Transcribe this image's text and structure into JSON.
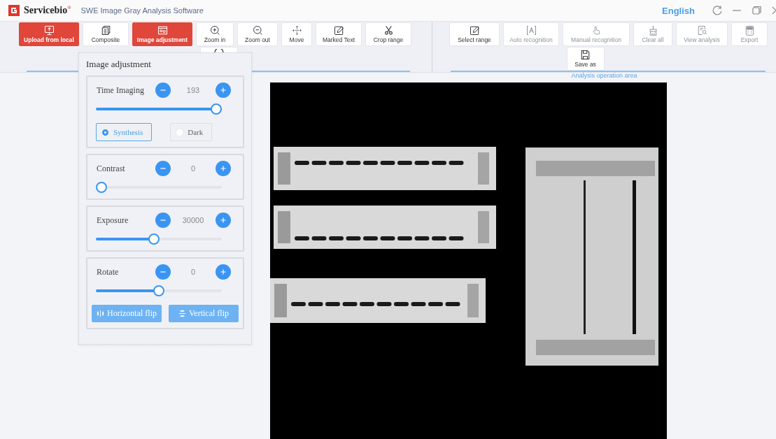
{
  "title_bar": {
    "logo": "Servicebio",
    "logo_mark": "®",
    "app_title": "SWE Image Gray Analysis Software",
    "language": "English"
  },
  "toolbar_left": [
    {
      "label": "Upload from local",
      "selected": true
    },
    {
      "label": "Composite",
      "selected": false
    },
    {
      "label": "Image adjustment",
      "selected": true
    },
    {
      "label": "Zoom in",
      "selected": false
    },
    {
      "label": "Zoom out",
      "selected": false
    },
    {
      "label": "Move",
      "selected": false
    },
    {
      "label": "Marked Text",
      "selected": false
    },
    {
      "label": "Crop range",
      "selected": false
    }
  ],
  "toolbar_right": [
    {
      "label": "Select range",
      "disabled": false
    },
    {
      "label": "Auto recognition",
      "disabled": true
    },
    {
      "label": "Manual recognition",
      "disabled": true
    },
    {
      "label": "Clear all",
      "disabled": true
    },
    {
      "label": "View analysis",
      "disabled": true
    },
    {
      "label": "Export",
      "disabled": true
    },
    {
      "label": "Save as",
      "disabled": false
    }
  ],
  "right_area_caption": "Analysis operation area",
  "panel": {
    "title": "Image adjustment",
    "controls": [
      {
        "label": "Time Imaging",
        "value": "193",
        "level": 1.0
      },
      {
        "label": "Contrast",
        "value": "0",
        "level": 0.0
      },
      {
        "label": "Exposure",
        "value": "30000",
        "level": 0.46
      },
      {
        "label": "Rotate",
        "value": "0",
        "level": 0.5
      }
    ],
    "modes": [
      {
        "label": "Synthesis",
        "selected": true
      },
      {
        "label": "Dark",
        "selected": false
      }
    ],
    "flip_buttons": [
      "Horizontal flip",
      "Vertical flip"
    ]
  }
}
